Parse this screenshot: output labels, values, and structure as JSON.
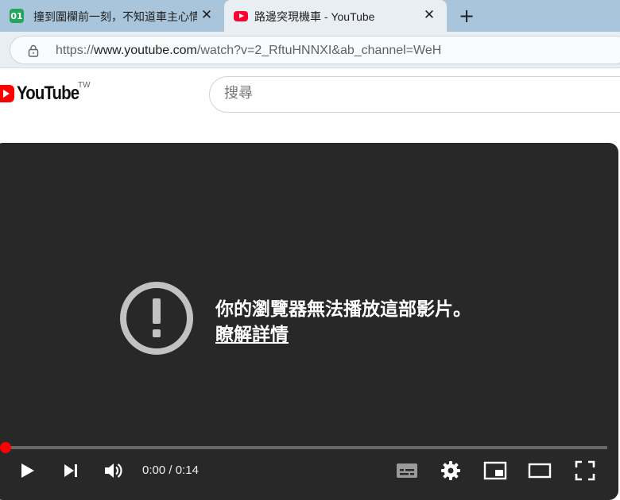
{
  "browser": {
    "tabs": [
      {
        "title": "撞到圍欄前一刻，不知道車主心情",
        "favicon": "site-favicon-green",
        "favicon_text": "01",
        "active": false
      },
      {
        "title": "路邊突現機車 - YouTube",
        "favicon": "youtube-favicon",
        "active": true
      }
    ],
    "close_glyph": "✕",
    "new_tab_glyph": "+",
    "url_scheme": "https://",
    "url_host": "www.youtube.com",
    "url_path": "/watch?v=2_RftuHNNXI&ab_channel=WeH"
  },
  "youtube": {
    "logo_text": "YouTube",
    "region": "TW",
    "search_placeholder": "搜尋"
  },
  "player": {
    "error_message": "你的瀏覽器無法播放這部影片。",
    "learn_more": "瞭解詳情",
    "time_current": "0:00",
    "time_separator": " / ",
    "time_total": "0:14",
    "progress_fraction": 0,
    "accent_color": "#ff0000"
  }
}
